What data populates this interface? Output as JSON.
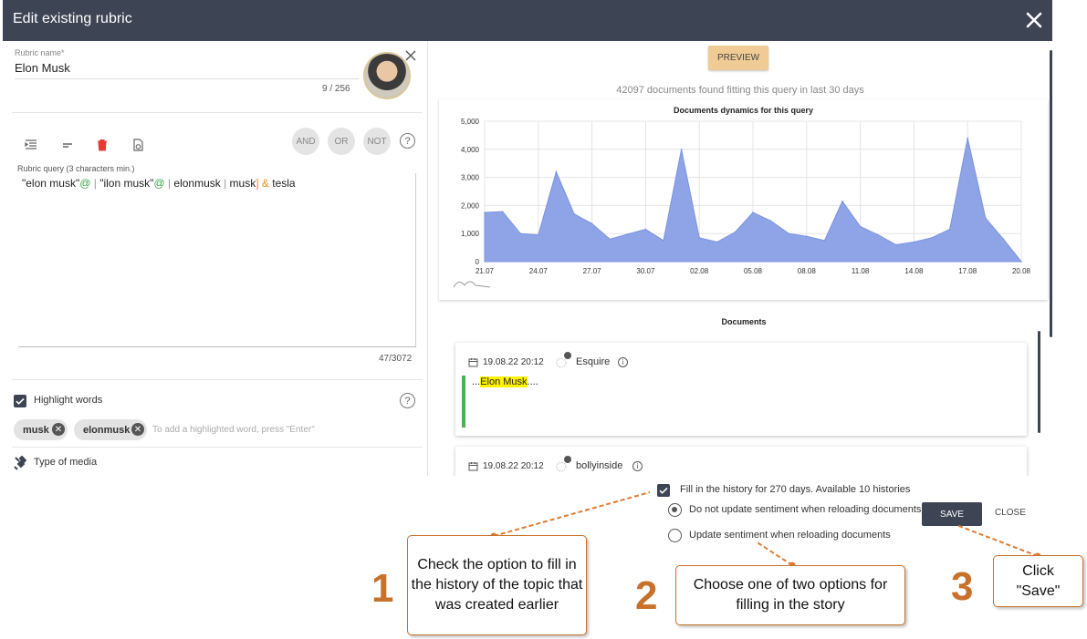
{
  "dialog": {
    "title": "Edit existing rubric",
    "close_icon": "close-icon"
  },
  "rubric": {
    "name_label": "Rubric name",
    "name_required_mark": "*",
    "name_value": "Elon Musk",
    "name_count": "9 / 256",
    "avatar_icon": "avatar-image"
  },
  "toolbar": {
    "icons": [
      "indent-icon",
      "dash-icon",
      "trash-icon",
      "refresh-file-icon"
    ],
    "trash_color": "#e53935",
    "and_label": "AND",
    "or_label": "OR",
    "not_label": "NOT",
    "help_label": "?"
  },
  "query": {
    "label": "Rubric query (3 characters min.)",
    "tokens": {
      "t1": "\"elon musk\"",
      "t2": "@",
      "t3": "  | ",
      "t4": "\"ilon musk\"",
      "t5": "@",
      "t6": "  | ",
      "t7": "elonmusk",
      "t8": " | ",
      "t9": "musk",
      "t10": "]",
      "t11": " & ",
      "t12": "tesla"
    },
    "count": "47/3072"
  },
  "highlight": {
    "label": "Highlight words",
    "checked": true,
    "chips": [
      "musk",
      "elonmusk"
    ],
    "hint": "To add a highlighted word,  press \"Enter\"",
    "help_label": "?"
  },
  "media": {
    "label": "Type of media",
    "icon": "satellite-icon"
  },
  "preview": {
    "button_label": "PREVIEW",
    "button_color": "#f0cb96",
    "found_text": "42097 documents found fitting this query in last 30 days"
  },
  "chart_data": {
    "type": "area",
    "title": "Documents dynamics for this query",
    "xlabel": "",
    "ylabel": "",
    "ylim": [
      0,
      5000
    ],
    "yticks": [
      0,
      1000,
      2000,
      3000,
      4000,
      5000
    ],
    "ytick_labels": [
      "0",
      "1,000",
      "2,000",
      "3,000",
      "4,000",
      "5,000"
    ],
    "x_tick_labels": [
      "21.07",
      "24.07",
      "27.07",
      "30.07",
      "02.08",
      "05.08",
      "08.08",
      "11.08",
      "14.08",
      "17.08",
      "20.08"
    ],
    "grid": true,
    "color": "#8fa4e6",
    "x": [
      "21.07",
      "22.07",
      "23.07",
      "24.07",
      "25.07",
      "26.07",
      "27.07",
      "28.07",
      "29.07",
      "30.07",
      "31.07",
      "01.08",
      "02.08",
      "03.08",
      "04.08",
      "05.08",
      "06.08",
      "07.08",
      "08.08",
      "09.08",
      "10.08",
      "11.08",
      "12.08",
      "13.08",
      "14.08",
      "15.08",
      "16.08",
      "17.08",
      "18.08",
      "19.08",
      "20.08"
    ],
    "values": [
      1750,
      1780,
      1000,
      950,
      3200,
      1700,
      1350,
      800,
      980,
      1150,
      750,
      4000,
      850,
      700,
      1050,
      1750,
      1450,
      1000,
      900,
      750,
      2150,
      1250,
      950,
      600,
      700,
      850,
      1150,
      4400,
      1550,
      800,
      0
    ],
    "series": [
      {
        "values": [
          1750,
          1780,
          1000,
          950,
          3200,
          1700,
          1350,
          800,
          980,
          1150,
          750,
          4000,
          850,
          700,
          1050,
          1750,
          1450,
          1000,
          900,
          750,
          2150,
          1250,
          950,
          600,
          700,
          850,
          1150,
          4400,
          1550,
          800,
          0
        ]
      }
    ]
  },
  "documents": {
    "title": "Documents",
    "items": [
      {
        "date": "19.08.22 20:12",
        "source": "Esquire",
        "snippet_pre": "...",
        "snippet_hl": "Elon Musk",
        "snippet_post": "...."
      },
      {
        "date": "19.08.22 20:12",
        "source": "bollyinside",
        "snippet_pre": "",
        "snippet_hl": "",
        "snippet_post": ""
      }
    ],
    "icons": [
      "calendar-icon",
      "globe-source-icon",
      "info-icon"
    ]
  },
  "history": {
    "fill_label": "Fill in the history for 270 days. Available 10 histories",
    "fill_checked": true,
    "opt1_label": "Do not update sentiment when reloading documents",
    "opt1_selected": true,
    "opt2_label": "Update sentiment when reloading documents",
    "opt2_selected": false,
    "save_label": "SAVE",
    "close_label": "CLOSE"
  },
  "callouts": {
    "step1_num": "1",
    "step1_text": "Check the option to fill in the history of the topic that was created earlier",
    "step2_num": "2",
    "step2_text": "Choose one of two options for filling in the story",
    "step3_num": "3",
    "step3_text": "Click \"Save\"",
    "accent": "#c8712b"
  }
}
